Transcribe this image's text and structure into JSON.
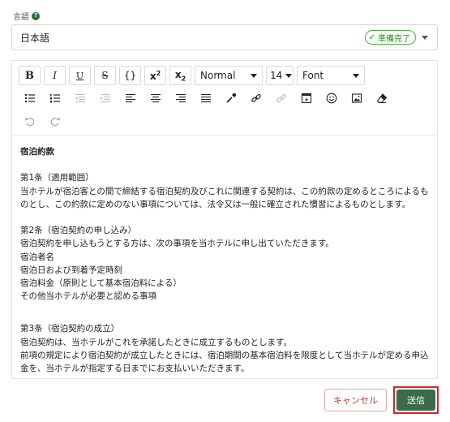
{
  "language": {
    "label": "言語",
    "help_icon": "?",
    "value": "日本語",
    "badge": "準備完了",
    "badge_icon": "check-icon"
  },
  "toolbar": {
    "bold": "B",
    "italic": "I",
    "underline": "U",
    "strike": "S",
    "code": "{}",
    "superscript_base": "x",
    "superscript_mark": "2",
    "subscript_base": "x",
    "subscript_mark": "2",
    "heading_value": "Normal",
    "size_value": "14",
    "font_value": "Font"
  },
  "document": {
    "title": "宿泊約款",
    "art1_heading": "第1条（適用範囲）",
    "art1_text": "当ホテルが宿泊客との間で締結する宿泊契約及びこれに関連する契約は、この約款の定めるところによるものとし、この約款に定めのない事項については、法令又は一般に確立された慣習によるものとします。",
    "art2_heading": "第2条（宿泊契約の申し込み）",
    "art2_text": "宿泊契約を申し込もうとする方は、次の事項を当ホテルに申し出ていただきます。",
    "art2_items": [
      "宿泊者名",
      "宿泊日および到着予定時刻",
      "宿泊料金（原則として基本宿泊料による）",
      "その他当ホテルが必要と認める事項"
    ],
    "art3_heading": "第3条（宿泊契約の成立）",
    "art3_text1": "宿泊契約は、当ホテルがこれを承諾したときに成立するものとします。",
    "art3_text2": "前項の規定により宿泊契約が成立したときには、宿泊期間の基本宿泊料を限度として当ホテルが定める申込金を、当ホテルが指定する日までにお支払いいただきます。"
  },
  "actions": {
    "cancel": "キャンセル",
    "submit": "送信"
  },
  "colors": {
    "accent": "#3a6b4b",
    "ready": "#2f8a2a",
    "cancel": "#c0392b",
    "highlight": "#e02020"
  }
}
